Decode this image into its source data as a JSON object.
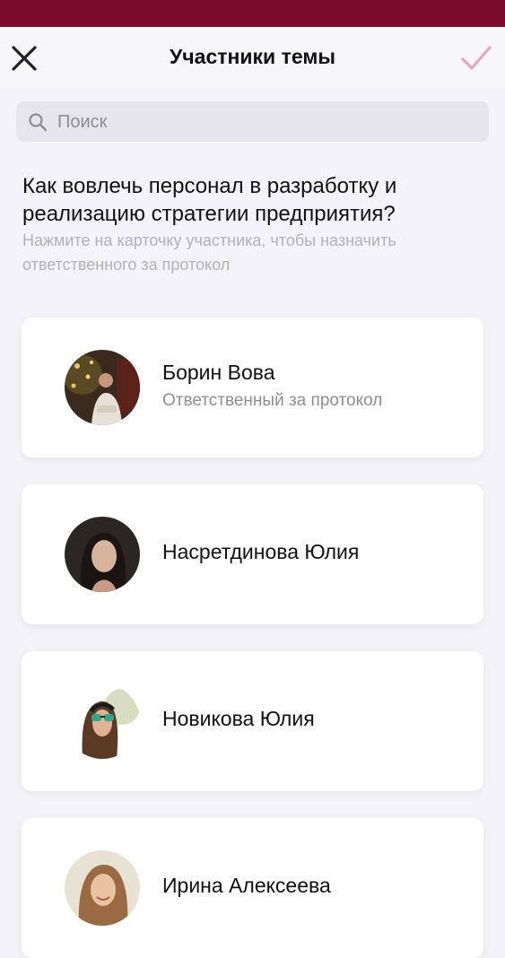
{
  "header": {
    "title": "Участники темы",
    "close_icon": "close-icon",
    "confirm_icon": "checkmark-icon",
    "accent_color": "#7c0a2e",
    "confirm_color": "#e8a8b8"
  },
  "search": {
    "placeholder": "Поиск",
    "value": "",
    "icon": "search-icon"
  },
  "topic": {
    "title": "Как вовлечь персонал в разработку и реализацию стратегии предприятия?",
    "hint": "Нажмите на карточку участника, чтобы назначить ответственного за протокол"
  },
  "participants": [
    {
      "name": "Борин Вова",
      "role": "Ответственный за протокол"
    },
    {
      "name": "Насретдинова Юлия"
    },
    {
      "name": "Новикова Юлия"
    },
    {
      "name": "Ирина Алексеева"
    }
  ]
}
